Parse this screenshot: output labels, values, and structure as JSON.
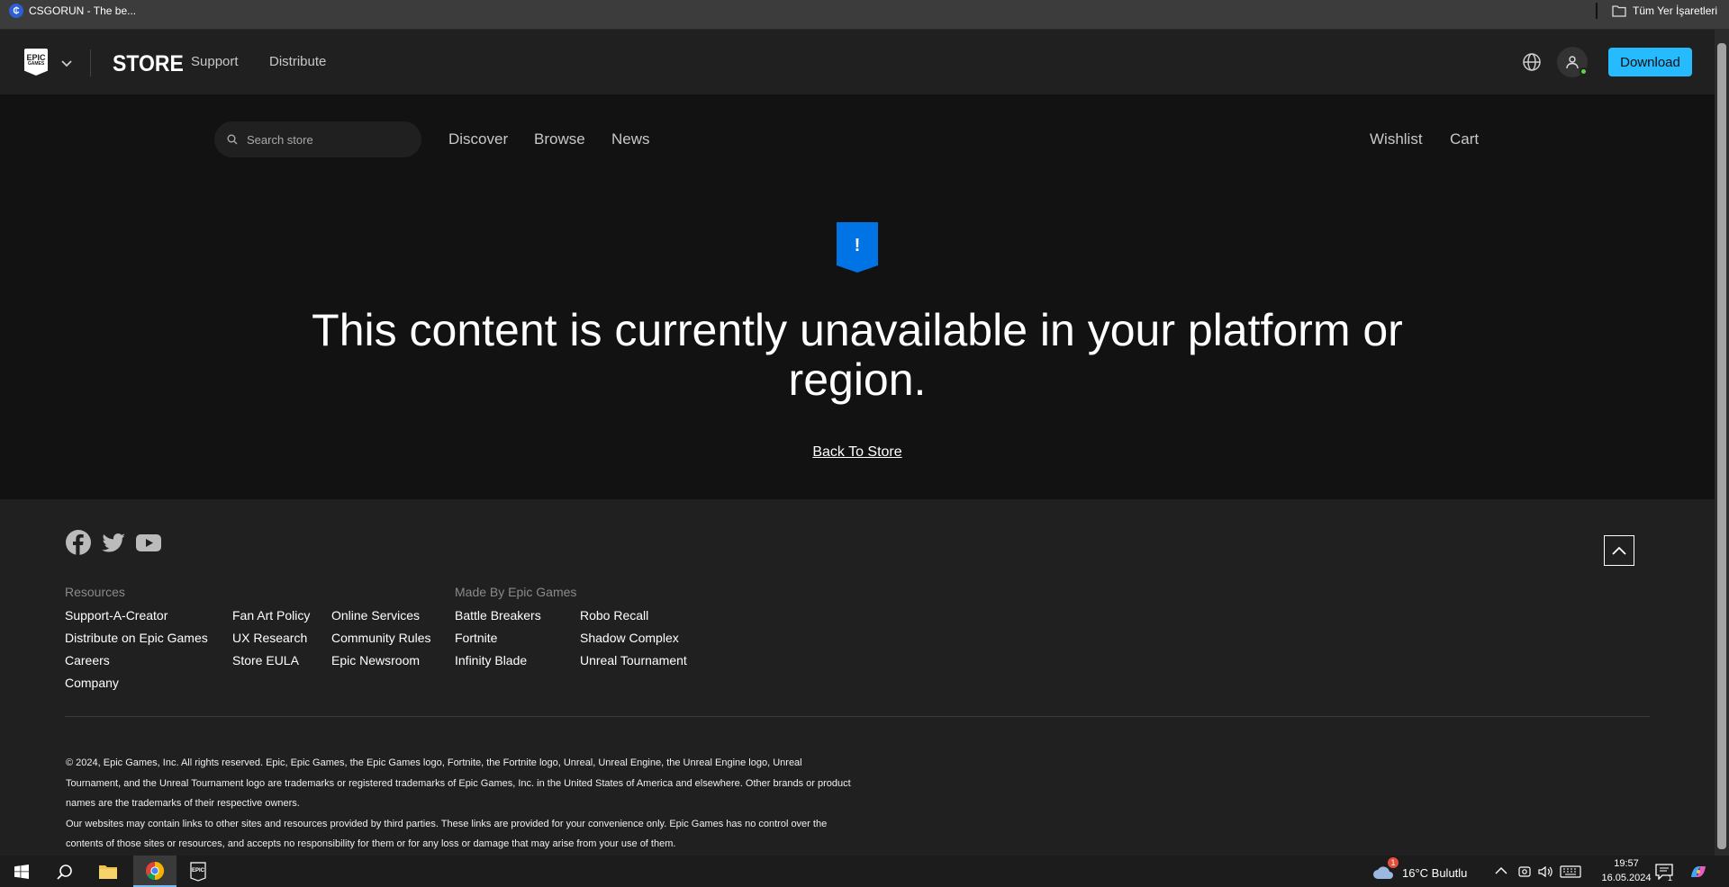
{
  "browser": {
    "tab_title": "CSGORUN - The be...",
    "bookmarks_folder": "Tüm Yer İşaretleri"
  },
  "header": {
    "logo_top": "EPIC",
    "logo_bottom": "GAMES",
    "store_label": "STORE",
    "links": [
      "Support",
      "Distribute"
    ],
    "download_label": "Download",
    "accent_color": "#26bbff"
  },
  "subnav": {
    "search_placeholder": "Search store",
    "links": [
      "Discover",
      "Browse",
      "News"
    ],
    "right_links": [
      "Wishlist",
      "Cart"
    ]
  },
  "error": {
    "icon_glyph": "!",
    "title": "This content is currently unavailable in your platform or region.",
    "back_link": "Back To Store",
    "icon_color": "#0074e4"
  },
  "footer": {
    "resources_heading": "Resources",
    "resources_col1": [
      "Support-A-Creator",
      "Distribute on Epic Games",
      "Careers",
      "Company"
    ],
    "resources_col2": [
      "Fan Art Policy",
      "UX Research",
      "Store EULA"
    ],
    "resources_col3": [
      "Online Services",
      "Community Rules",
      "Epic Newsroom"
    ],
    "made_heading": "Made By Epic Games",
    "made_col1": [
      "Battle Breakers",
      "Fortnite",
      "Infinity Blade"
    ],
    "made_col2": [
      "Robo Recall",
      "Shadow Complex",
      "Unreal Tournament"
    ],
    "legal_1": "© 2024, Epic Games, Inc. All rights reserved. Epic, Epic Games, the Epic Games logo, Fortnite, the Fortnite logo, Unreal, Unreal Engine, the Unreal Engine logo, Unreal Tournament, and the Unreal Tournament logo are trademarks or registered trademarks of Epic Games, Inc. in the United States of America and elsewhere. Other brands or product names are the trademarks of their respective owners.",
    "legal_2": "Our websites may contain links to other sites and resources provided by third parties. These links are provided for your convenience only. Epic Games has no control over the contents of those sites or resources, and accepts no responsibility for them or for any loss or damage that may arise from your use of them."
  },
  "taskbar": {
    "weather": "16°C  Bulutlu",
    "time": "19:57",
    "date": "16.05.2024",
    "notification_count": "1",
    "weather_badge": "1"
  }
}
